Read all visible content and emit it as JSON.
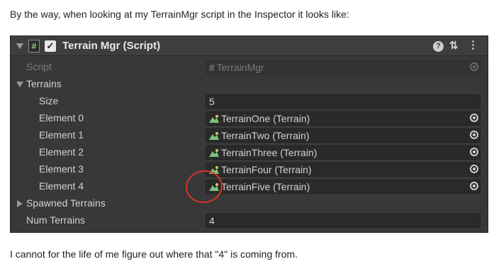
{
  "post": {
    "intro": "By the way, when looking at my TerrainMgr script in the Inspector it looks like:",
    "outro": "I cannot for the life of me figure out where that \"4\" is coming from."
  },
  "inspector": {
    "title": "Terrain Mgr (Script)",
    "script_label": "Script",
    "script_value": "TerrainMgr",
    "terrains_label": "Terrains",
    "size_label": "Size",
    "size_value": "5",
    "elements": [
      {
        "label": "Element 0",
        "value": "TerrainOne (Terrain)"
      },
      {
        "label": "Element 1",
        "value": "TerrainTwo (Terrain)"
      },
      {
        "label": "Element 2",
        "value": "TerrainThree (Terrain)"
      },
      {
        "label": "Element 3",
        "value": "TerrainFour (Terrain)"
      },
      {
        "label": "Element 4",
        "value": "TerrainFive (Terrain)"
      }
    ],
    "spawned_label": "Spawned Terrains",
    "num_label": "Num Terrains",
    "num_value": "4",
    "icons": [
      "foldout-arrow-icon",
      "script-icon",
      "checkbox-icon",
      "help-icon",
      "settings-icon",
      "menu-icon",
      "terrain-icon",
      "object-picker-icon"
    ],
    "colors": {
      "panel": "#383838",
      "field": "#2a2a2a",
      "highlight": "#d9332a"
    }
  }
}
